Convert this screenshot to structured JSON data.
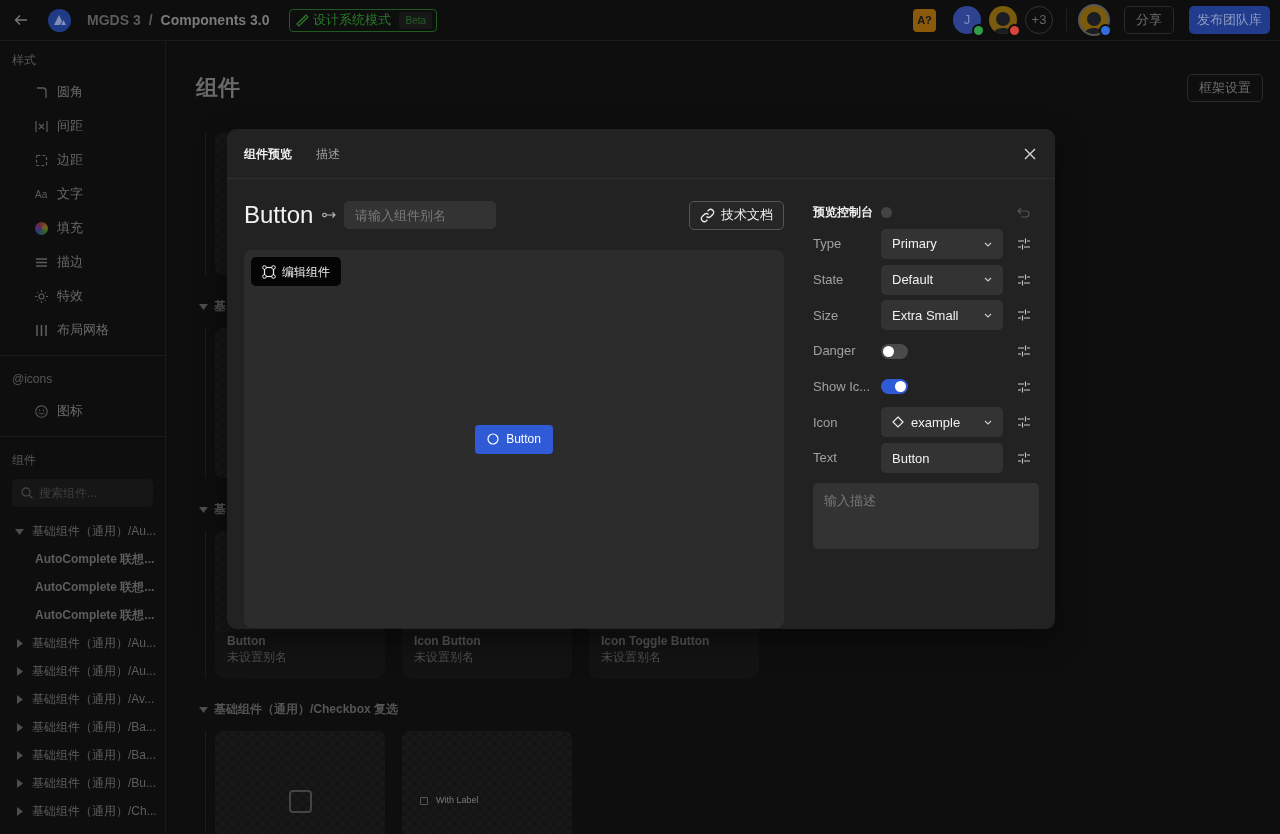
{
  "topbar": {
    "project": "MGDS 3",
    "separator": "/",
    "file": "Components 3.0",
    "mode_badge": "设计系统模式",
    "beta": "Beta",
    "lang_badge": "A?",
    "collaborators": [
      {
        "kind": "letter",
        "initial": "J",
        "color": "#2f9e44"
      },
      {
        "kind": "photo",
        "color": "#d9443a"
      }
    ],
    "more_count": "+3",
    "me": {
      "color": "#2f6fe0"
    },
    "share": "分享",
    "publish": "发布团队库"
  },
  "sidebar": {
    "styles_heading": "样式",
    "style_items": [
      {
        "label": "圆角"
      },
      {
        "label": "间距"
      },
      {
        "label": "边距"
      },
      {
        "label": "文字",
        "glyph": "Aa"
      },
      {
        "label": "填充"
      },
      {
        "label": "描边"
      },
      {
        "label": "特效"
      },
      {
        "label": "布局网格"
      }
    ],
    "icons_heading": "@icons",
    "icon_items": [
      {
        "label": "图标"
      }
    ],
    "components_heading": "组件",
    "search": {
      "placeholder": "搜索组件..."
    },
    "tree": [
      {
        "label": "基础组件（通用）/Au...",
        "expanded": true,
        "children": [
          {
            "label": "AutoComplete 联想..."
          },
          {
            "label": "AutoComplete 联想..."
          },
          {
            "label": "AutoComplete 联想..."
          }
        ]
      },
      {
        "label": "基础组件（通用）/Au...",
        "expanded": false
      },
      {
        "label": "基础组件（通用）/Au...",
        "expanded": false
      },
      {
        "label": "基础组件（通用）/Av...",
        "expanded": false
      },
      {
        "label": "基础组件（通用）/Ba...",
        "expanded": false
      },
      {
        "label": "基础组件（通用）/Ba...",
        "expanded": false
      },
      {
        "label": "基础组件（通用）/Bu...",
        "expanded": false
      },
      {
        "label": "基础组件（通用）/Ch...",
        "expanded": false
      }
    ]
  },
  "main": {
    "title": "组件",
    "frame_settings": "框架设置",
    "sections": [
      {
        "cards": [
          {
            "kind": "blank"
          }
        ]
      },
      {
        "title": "基",
        "expanded": true,
        "cards": [
          {
            "kind": "blank"
          }
        ]
      },
      {
        "title": "基",
        "expanded": true,
        "cards": [
          {
            "kind": "named",
            "title": "Button",
            "alias": "未设置别名"
          },
          {
            "kind": "named",
            "title": "Icon Button",
            "alias": "未设置别名"
          },
          {
            "kind": "named",
            "title": "Icon Toggle Button",
            "alias": "未设置别名"
          }
        ]
      },
      {
        "title": "基础组件（通用）/Checkbox 复选",
        "expanded": true,
        "cards": [
          {
            "kind": "checkbox",
            "checked": false
          },
          {
            "kind": "checkbox",
            "checked": false,
            "label": "With Label"
          }
        ]
      }
    ]
  },
  "modal": {
    "tabs": [
      {
        "label": "组件预览",
        "selected": true
      },
      {
        "label": "描述",
        "selected": false
      }
    ],
    "component_name": "Button",
    "alias_placeholder": "请输入组件别名",
    "docs_button": "技术文档",
    "edit_button": "编辑组件",
    "preview_button": {
      "label": "Button"
    },
    "console": {
      "title": "预览控制台",
      "props": [
        {
          "label": "Type",
          "kind": "select",
          "value": "Primary"
        },
        {
          "label": "State",
          "kind": "select",
          "value": "Default"
        },
        {
          "label": "Size",
          "kind": "select",
          "value": "Extra Small"
        },
        {
          "label": "Danger",
          "kind": "toggle",
          "on": false
        },
        {
          "label": "Show Ic...",
          "kind": "toggle",
          "on": true
        },
        {
          "label": "Icon",
          "kind": "icon-select",
          "value": "example"
        },
        {
          "label": "Text",
          "kind": "text",
          "value": "Button"
        }
      ],
      "description_placeholder": "输入描述"
    }
  }
}
